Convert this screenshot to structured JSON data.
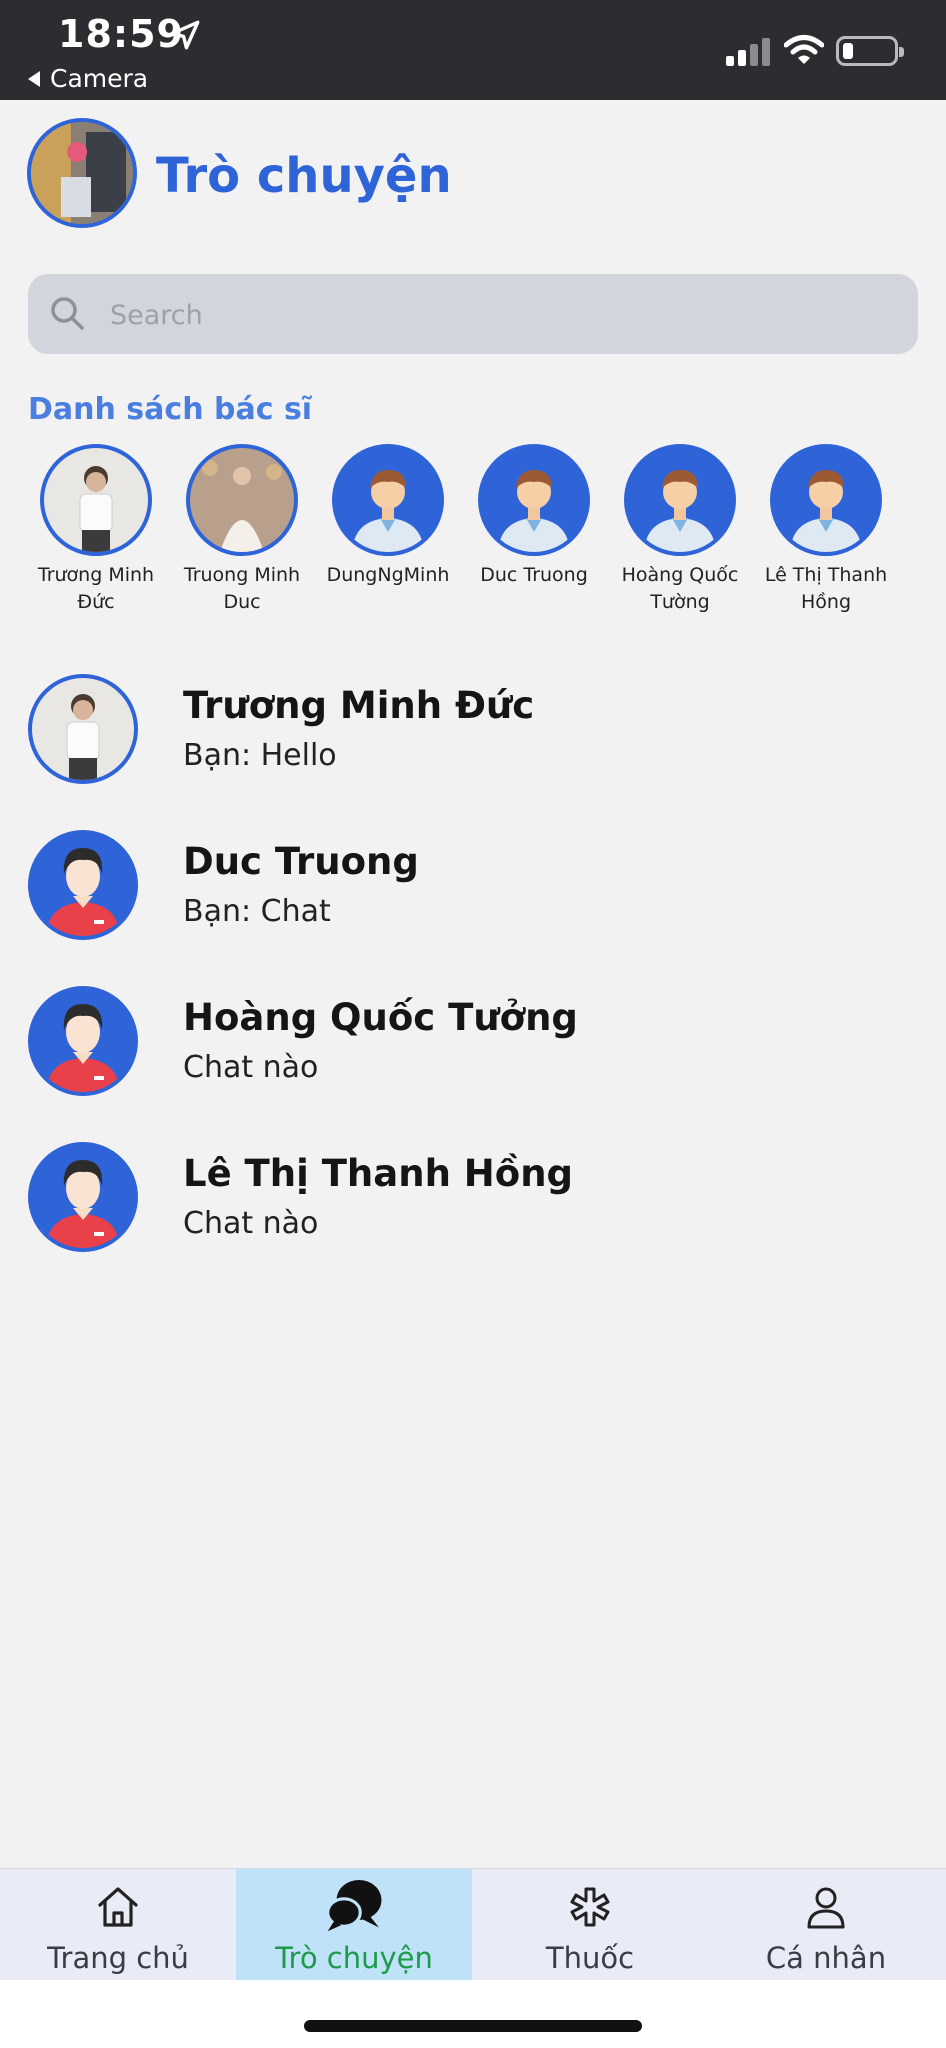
{
  "status_bar": {
    "time": "18:59",
    "back_label": "Camera"
  },
  "header": {
    "title": "Trò chuyện"
  },
  "search": {
    "placeholder": "Search"
  },
  "doctors_section": {
    "title": "Danh sách bác sĩ",
    "doctors": [
      {
        "name": "Trương Minh Đức",
        "avatar": "photo-man"
      },
      {
        "name": "Truong Minh Duc",
        "avatar": "photo-bride"
      },
      {
        "name": "DungNgMinh",
        "avatar": "doctor-avatar"
      },
      {
        "name": "Duc Truong",
        "avatar": "doctor-avatar"
      },
      {
        "name": "Hoàng Quốc Tường",
        "avatar": "doctor-avatar"
      },
      {
        "name": "Lê Thị Thanh Hồng",
        "avatar": "doctor-avatar"
      }
    ]
  },
  "conversations": [
    {
      "name": "Trương Minh Đức",
      "last_message": "Bạn: Hello",
      "avatar": "photo-man"
    },
    {
      "name": "Duc Truong",
      "last_message": "Bạn: Chat",
      "avatar": "user-avatar"
    },
    {
      "name": "Hoàng Quốc Tưởng",
      "last_message": "Chat nào",
      "avatar": "user-avatar"
    },
    {
      "name": "Lê Thị Thanh Hồng",
      "last_message": "Chat nào",
      "avatar": "user-avatar"
    }
  ],
  "bottom_nav": {
    "tabs": [
      {
        "label": "Trang chủ",
        "icon": "home-icon",
        "active": false
      },
      {
        "label": "Trò chuyện",
        "icon": "chat-bubbles-icon",
        "active": true
      },
      {
        "label": "Thuốc",
        "icon": "medical-star-icon",
        "active": false
      },
      {
        "label": "Cá nhân",
        "icon": "person-icon",
        "active": false
      }
    ]
  },
  "colors": {
    "accent": "#2f64d8",
    "section_title": "#4a7ee0",
    "active_tab_bg": "#bfe2f8",
    "active_tab_text": "#1d9a4a"
  }
}
